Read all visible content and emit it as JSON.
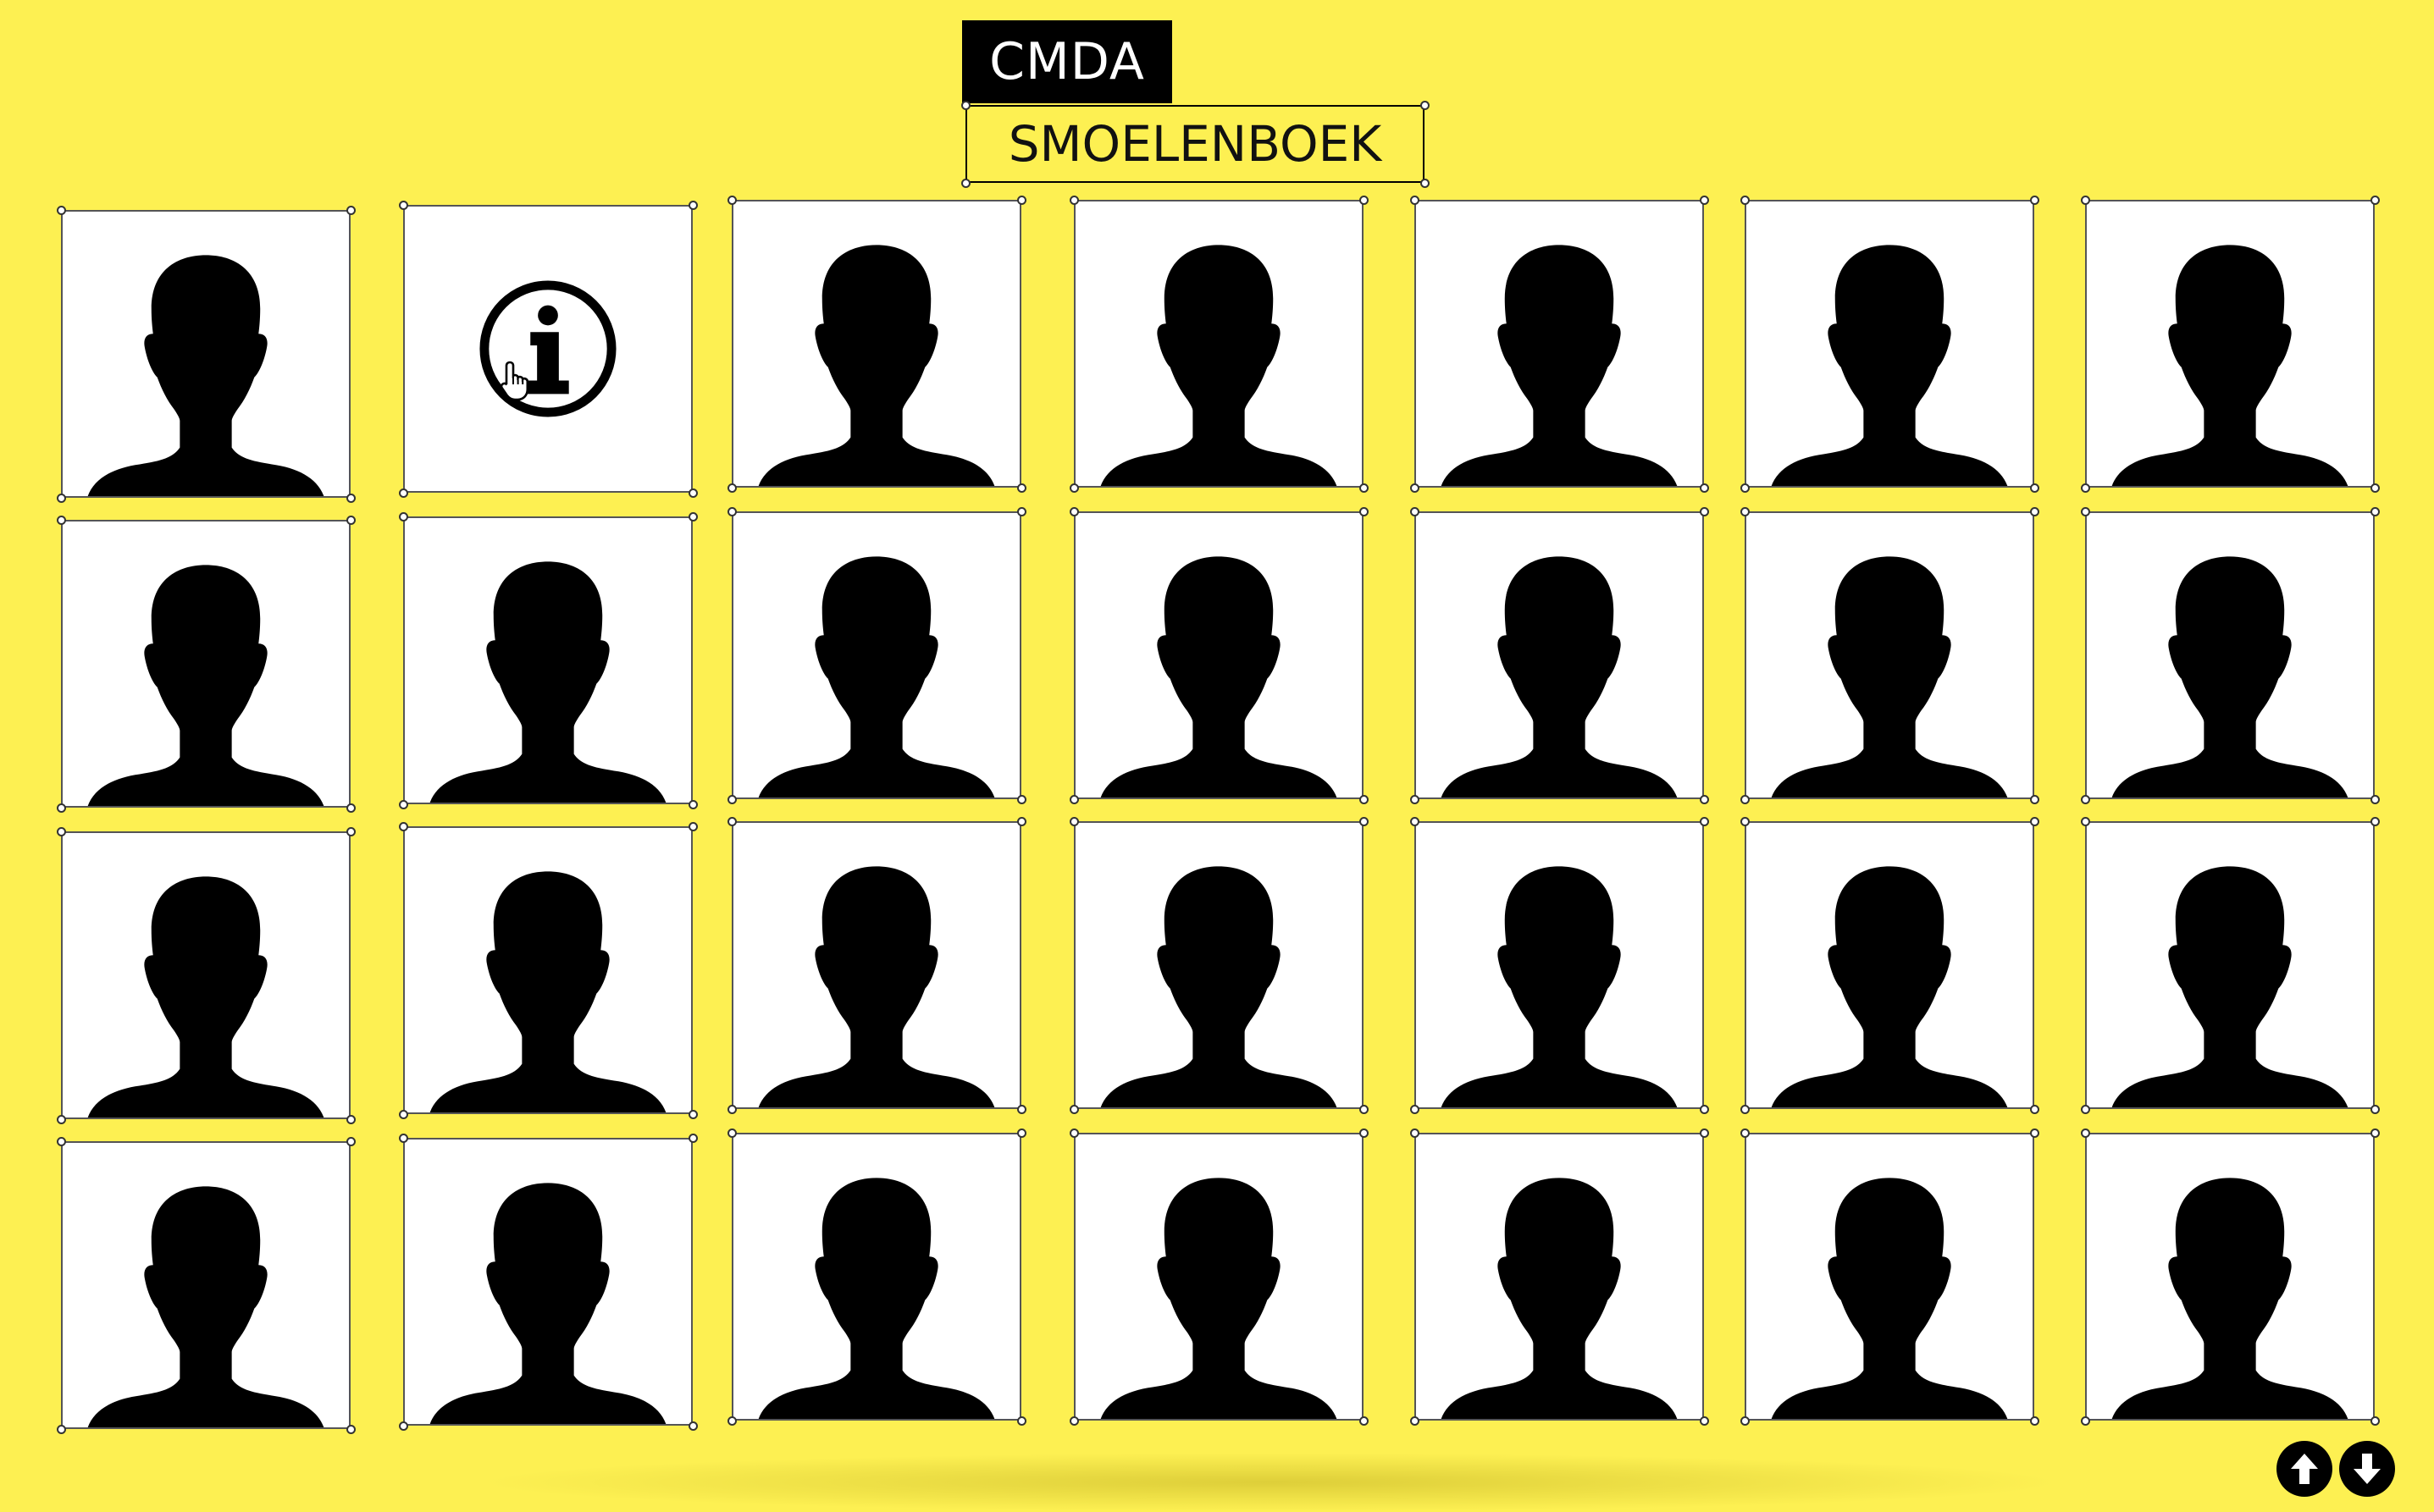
{
  "header": {
    "brand": "CMDA",
    "title": "SMOELENBOEK"
  },
  "grid": {
    "columns": 7,
    "rows": 4,
    "info_tile": {
      "row": 0,
      "col": 1,
      "icon": "info-icon"
    },
    "tile_icon": "person-silhouette-icon"
  },
  "cursor": {
    "icon": "hand-pointer-icon"
  },
  "scroll_controls": {
    "up_icon": "arrow-up-icon",
    "down_icon": "arrow-down-icon"
  },
  "colors": {
    "background": "#fdf052",
    "tile": "#ffffff",
    "silhouette": "#000000",
    "header_bg": "#000000",
    "header_text": "#ffffff"
  }
}
